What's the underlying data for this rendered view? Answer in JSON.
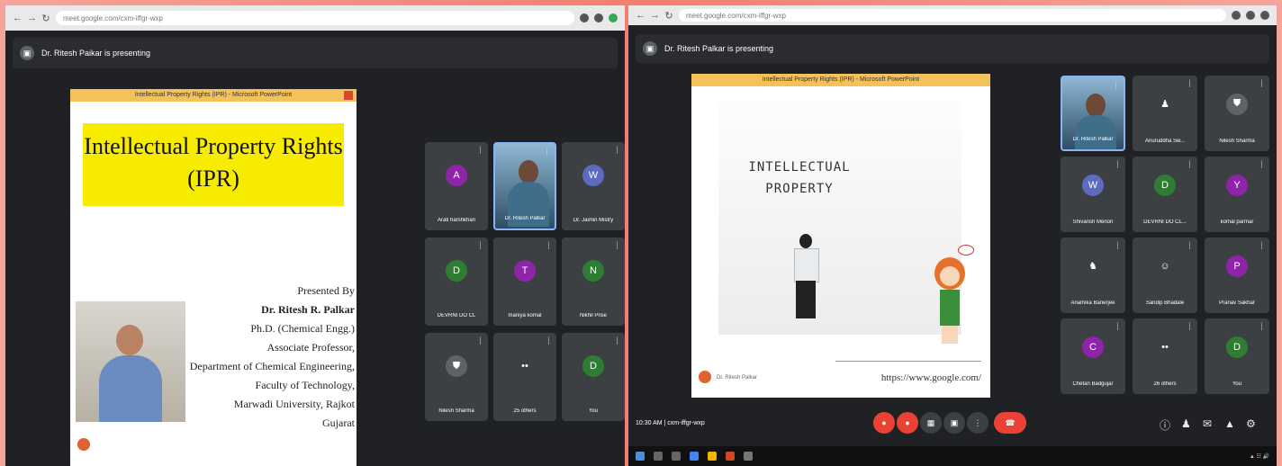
{
  "left": {
    "url": "meet.google.com/cxm-iffgr-wxp",
    "presenting": "Dr. Ritesh Paikar is presenting",
    "slide_titlebar": "Intellectual Property Rights (IPR) - Microsoft PowerPoint",
    "slide_title_line1": "Intellectual Property Rights",
    "slide_title_line2": "(IPR)",
    "credits": [
      "Presented By",
      "Dr. Ritesh R. Palkar",
      "Ph.D. (Chemical Engg.)",
      "Associate Professor,",
      "Department of Chemical Engineering,",
      "Faculty of Technology,",
      "Marwadi University, Rajkot",
      "Gujarat"
    ],
    "tiles": [
      {
        "name": "Arati harshkhari",
        "initial": "A",
        "color": "#8e24aa"
      },
      {
        "name": "Dr. Ritesh Palkar",
        "initial": "",
        "color": "",
        "video": true
      },
      {
        "name": "Dr. Jaimin Mistry",
        "initial": "W",
        "color": "#5c6bc0"
      },
      {
        "name": "DEVRNI DO CL",
        "initial": "D",
        "color": "#2e7d32"
      },
      {
        "name": "maniya komal",
        "initial": "T",
        "color": "#8e24aa"
      },
      {
        "name": "Nikhil Prise",
        "initial": "N",
        "color": "#2e7d32"
      },
      {
        "name": "Nilesh Sharma",
        "initial": "⛊",
        "color": "#5f6368"
      },
      {
        "name": "25 others",
        "initial": "••",
        "color": "#3c4043"
      },
      {
        "name": "You",
        "initial": "D",
        "color": "#2e7d32"
      }
    ]
  },
  "right": {
    "url": "meet.google.com/cxm-iffgr-wxp",
    "presenting": "Dr. Ritesh Palkar is presenting",
    "slide_titlebar": "Intellectual Property Rights (IPR) - Microsoft PowerPoint",
    "art_text_line1": "INTELLECTUAL",
    "art_text_line2": "PROPERTY",
    "slide_url": "https://www.google.com/",
    "slide_footer": "Dr. Ritesh Palkar",
    "meeting_time": "10:30 AM",
    "meeting_code": "cxm-iffgr-wxp",
    "tiles": [
      {
        "name": "Dr. Ritesh Palkar",
        "initial": "",
        "color": "",
        "video": true
      },
      {
        "name": "Anuruddha Sw...",
        "initial": "♟",
        "color": "#3c4043"
      },
      {
        "name": "Nilesh Sharma",
        "initial": "⛊",
        "color": "#5f6368"
      },
      {
        "name": "Shivansh Menon",
        "initial": "W",
        "color": "#5c6bc0"
      },
      {
        "name": "DEVRNI DO CL...",
        "initial": "D",
        "color": "#2e7d32"
      },
      {
        "name": "komal parmar",
        "initial": "Y",
        "color": "#8e24aa"
      },
      {
        "name": "Anamika Banerjee",
        "initial": "♞",
        "color": "#3c4043"
      },
      {
        "name": "Sandip Bhadale",
        "initial": "☺",
        "color": "#3c4043"
      },
      {
        "name": "Pranav Sakhar",
        "initial": "P",
        "color": "#8e24aa"
      },
      {
        "name": "Chetan Badgujar",
        "initial": "C",
        "color": "#8e24aa"
      },
      {
        "name": "26 others",
        "initial": "••",
        "color": "#3c4043"
      },
      {
        "name": "You",
        "initial": "D",
        "color": "#2e7d32"
      }
    ]
  },
  "colors": {
    "accent": "#ea4335",
    "slide_yellow": "#f7ec00",
    "tile_bg": "#3c4043"
  }
}
